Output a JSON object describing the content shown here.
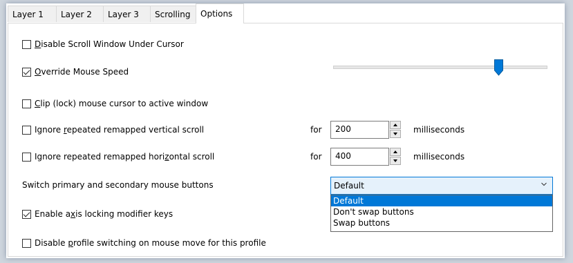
{
  "tabs": [
    {
      "label": "Layer 1",
      "active": false
    },
    {
      "label": "Layer 2",
      "active": false
    },
    {
      "label": "Layer 3",
      "active": false
    },
    {
      "label": "Scrolling",
      "active": false
    },
    {
      "label": "Options",
      "active": true
    }
  ],
  "options": {
    "disable_scroll_window": {
      "label_pre": "",
      "label_ul": "D",
      "label_post": "isable Scroll Window Under Cursor",
      "checked": false
    },
    "override_mouse_speed": {
      "label_pre": "",
      "label_ul": "O",
      "label_post": "verride Mouse Speed",
      "checked": true
    },
    "mouse_speed_level": 0.78,
    "clip_cursor": {
      "label_pre": "",
      "label_ul": "C",
      "label_post": "lip (lock) mouse cursor to active window",
      "checked": false
    },
    "ignore_vertical": {
      "label_pre": "Ignore ",
      "label_ul": "r",
      "label_post": "epeated remapped vertical scroll",
      "checked": false,
      "for_label": "for",
      "value": "200",
      "unit": "milliseconds"
    },
    "ignore_horizontal": {
      "label_pre": "Ignore repeated remapped hori",
      "label_ul": "z",
      "label_post": "ontal scroll",
      "checked": false,
      "for_label": "for",
      "value": "400",
      "unit": "milliseconds"
    },
    "switch_buttons": {
      "label": "Switch primary and secondary mouse buttons",
      "selected": "Default",
      "options": [
        "Default",
        "Don't swap buttons",
        "Swap buttons"
      ]
    },
    "axis_locking": {
      "label_pre": "Enable a",
      "label_ul": "x",
      "label_post": "is locking modifier keys",
      "checked": true
    },
    "disable_profile_switching": {
      "label_pre": "Disable ",
      "label_ul": "p",
      "label_post": "rofile switching on mouse move for this profile",
      "checked": false
    }
  },
  "colors": {
    "accent": "#0078d7",
    "combo_bg": "#e5f1fb",
    "slider_thumb": "#0078d7"
  }
}
